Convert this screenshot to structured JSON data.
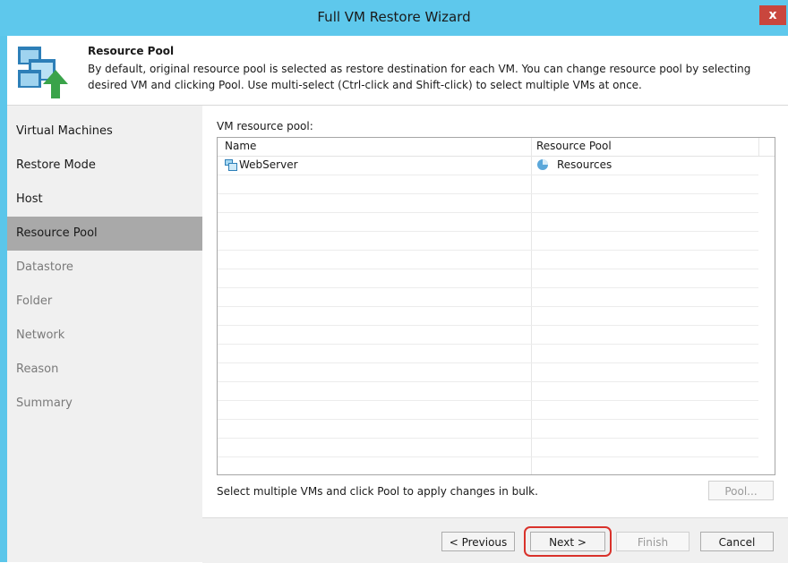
{
  "window": {
    "title": "Full VM Restore Wizard",
    "close_label": "x"
  },
  "header": {
    "title": "Resource Pool",
    "description": "By default, original resource pool is selected as restore destination for each VM. You can change resource pool by selecting desired VM and clicking Pool. Use multi-select (Ctrl-click and Shift-click) to select multiple VMs at once."
  },
  "steps": [
    {
      "label": "Virtual Machines",
      "state": "done"
    },
    {
      "label": "Restore Mode",
      "state": "done"
    },
    {
      "label": "Host",
      "state": "done"
    },
    {
      "label": "Resource Pool",
      "state": "active"
    },
    {
      "label": "Datastore",
      "state": "disabled"
    },
    {
      "label": "Folder",
      "state": "disabled"
    },
    {
      "label": "Network",
      "state": "disabled"
    },
    {
      "label": "Reason",
      "state": "disabled"
    },
    {
      "label": "Summary",
      "state": "disabled"
    }
  ],
  "main": {
    "pool_label": "VM resource pool:",
    "columns": {
      "name": "Name",
      "pool": "Resource Pool"
    },
    "rows": [
      {
        "name": "WebServer",
        "pool": "Resources"
      }
    ],
    "hint": "Select multiple VMs and click Pool to apply changes in bulk.",
    "pool_button": "Pool..."
  },
  "footer": {
    "previous": "< Previous",
    "next": "Next >",
    "finish": "Finish",
    "cancel": "Cancel"
  },
  "colors": {
    "titlebar": "#5ec8ec",
    "active_step": "#a9a9a9",
    "highlight": "#d9322b",
    "close": "#c9463d"
  }
}
